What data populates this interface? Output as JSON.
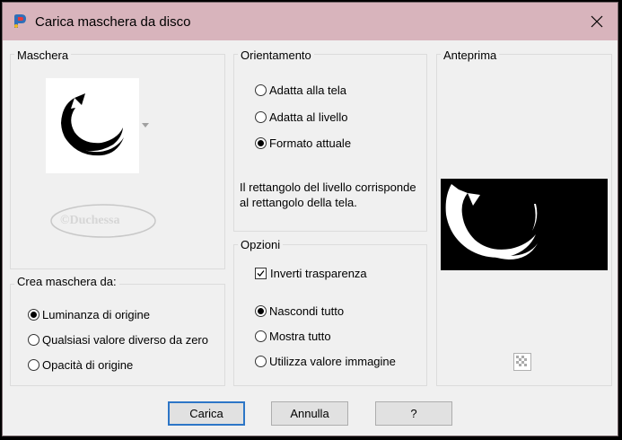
{
  "window": {
    "title": "Carica maschera da disco",
    "close_icon": "close-x-icon",
    "app_icon": "paintshop-pro-icon"
  },
  "mask_group": {
    "label": "Maschera",
    "watermark": "©Duchessa"
  },
  "create_from_group": {
    "label": "Crea maschera da:",
    "options": [
      {
        "label": "Luminanza di origine",
        "selected": true
      },
      {
        "label": "Qualsiasi valore diverso da zero",
        "selected": false
      },
      {
        "label": "Opacità di origine",
        "selected": false
      }
    ]
  },
  "orientation_group": {
    "label": "Orientamento",
    "options": [
      {
        "label": "Adatta alla tela",
        "selected": false
      },
      {
        "label": "Adatta al livello",
        "selected": false
      },
      {
        "label": "Formato attuale",
        "selected": true
      }
    ],
    "description": "Il rettangolo del livello corrisponde al rettangolo della tela."
  },
  "options_group": {
    "label": "Opzioni",
    "invert_label": "Inverti trasparenza",
    "invert_checked": true,
    "options": [
      {
        "label": "Nascondi tutto",
        "selected": true
      },
      {
        "label": "Mostra tutto",
        "selected": false
      },
      {
        "label": "Utilizza valore immagine",
        "selected": false
      }
    ]
  },
  "preview_group": {
    "label": "Anteprima"
  },
  "buttons": {
    "load": "Carica",
    "cancel": "Annulla",
    "help": "?"
  },
  "colors": {
    "titlebar": "#d8b4bc",
    "dialog_bg": "#f0f0f0",
    "default_button_border": "#2d76c7"
  }
}
